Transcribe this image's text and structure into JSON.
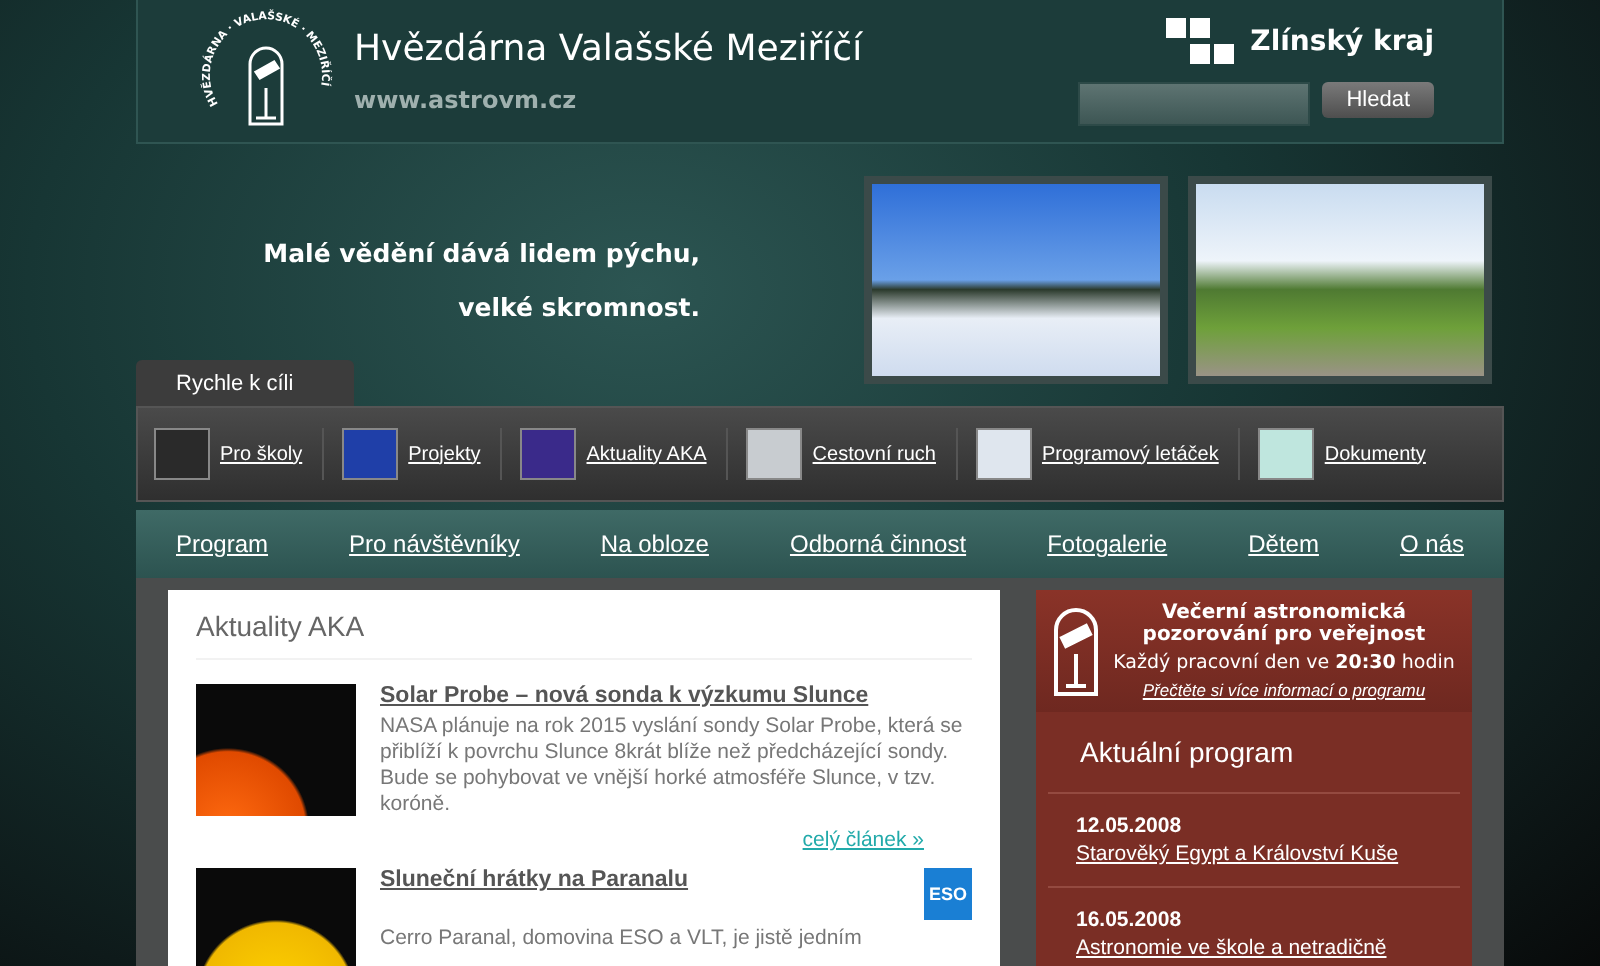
{
  "header": {
    "logo_ring": "HVĚZDÁRNA · VALAŠSKÉ · MEZIŘÍČÍ",
    "title": "Hvězdárna Valašské Meziříčí",
    "url": "www.astrovm.cz",
    "region_logo": "Zlínský kraj",
    "search_button": "Hledat"
  },
  "hero": {
    "motto": [
      "Malé vědění dává lidem pýchu,",
      "velké skromnost."
    ]
  },
  "quick_links": {
    "tab": "Rychle k cíli",
    "items": [
      {
        "label": "Pro školy",
        "color": "#2a2a2a"
      },
      {
        "label": "Projekty",
        "color": "#1f3fa8"
      },
      {
        "label": "Aktuality AKA",
        "color": "#3a2a8a"
      },
      {
        "label": "Cestovní ruch",
        "color": "#c8ccd0"
      },
      {
        "label": "Programový letáček",
        "color": "#dfe6ee"
      },
      {
        "label": "Dokumenty",
        "color": "#bfe6de"
      }
    ]
  },
  "nav": [
    "Program",
    "Pro návštěvníky",
    "Na obloze",
    "Odborná činnost",
    "Fotogalerie",
    "Dětem",
    "O nás"
  ],
  "news": {
    "title": "Aktuality AKA",
    "articles": [
      {
        "title": "Solar Probe – nová sonda k výzkumu Slunce",
        "text": "NASA plánuje na rok 2015 vyslání sondy Solar Probe, která se přiblíží k povrchu Slunce 8krát blíže než předcházející sondy. Bude se pohybovat ve vnější horké atmosféře Slunce, v tzv. koróně.",
        "more": "celý článek »"
      },
      {
        "title": "Sluneční hrátky na Paranalu",
        "text": "Cerro Paranal, domovina ESO a VLT, je jistě jedním",
        "logo": "ESO"
      }
    ]
  },
  "sidebar": {
    "promo": {
      "title": "Večerní astronomická pozorování pro veřejnost",
      "schedule": "Každý pracovní den ve **20:30** hodin",
      "link": "Přečtěte si více informací o programu"
    },
    "program_title": "Aktuální program",
    "events": [
      {
        "date": "12.05.2008",
        "title": "Starověký Egypt a Království Kuše"
      },
      {
        "date": "16.05.2008",
        "title": "Astronomie ve škole a netradičně"
      }
    ]
  }
}
